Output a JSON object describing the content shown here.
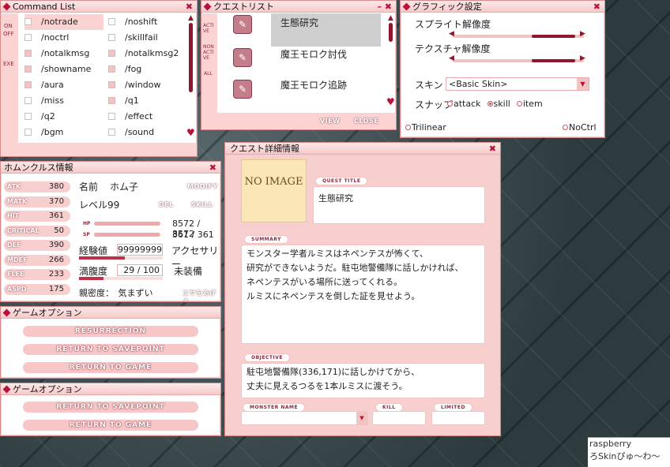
{
  "command_list": {
    "title": "Command List",
    "side": [
      "ON",
      "OFF",
      "EXE"
    ],
    "left": [
      {
        "label": "/notrade",
        "on": false,
        "selected": true
      },
      {
        "label": "/noctrl",
        "on": false
      },
      {
        "label": "/notalkmsg",
        "on": true
      },
      {
        "label": "/showname",
        "on": true
      },
      {
        "label": "/aura",
        "on": true
      },
      {
        "label": "/miss",
        "on": false
      },
      {
        "label": "/q2",
        "on": false
      },
      {
        "label": "/bgm",
        "on": false
      }
    ],
    "right": [
      {
        "label": "/noshift",
        "on": false
      },
      {
        "label": "/skillfail",
        "on": false
      },
      {
        "label": "/notalkmsg2",
        "on": true
      },
      {
        "label": "/fog",
        "on": true
      },
      {
        "label": "/window",
        "on": true
      },
      {
        "label": "/q1",
        "on": true
      },
      {
        "label": "/effect",
        "on": false
      },
      {
        "label": "/sound",
        "on": false
      }
    ]
  },
  "quest_list": {
    "title": "クエストリスト",
    "side": [
      "ACTI",
      "VE",
      "NON",
      "ACTI",
      "VE",
      "ALL"
    ],
    "items": [
      "生態研究",
      "魔王モロク討伐",
      "魔王モロク追跡"
    ],
    "view_label": "VIEW",
    "close_label": "CLOSE"
  },
  "graphic_settings": {
    "title": "グラフィック設定",
    "sprite_label": "スプライト解像度",
    "texture_label": "テクスチャ解像度",
    "skin_label": "スキン",
    "skin_value": "<Basic Skin>",
    "snap_label": "スナップ",
    "snap_options": [
      {
        "label": "attack",
        "on": false
      },
      {
        "label": "skill",
        "on": true
      },
      {
        "label": "item",
        "on": false
      }
    ],
    "trilinear_label": "Trilinear",
    "noctrl_label": "NoCtrl",
    "sprite_level": 0.6,
    "texture_level": 0.6
  },
  "homunculus": {
    "title": "ホムンクルス情報",
    "stats": [
      {
        "name": "ATK",
        "value": "380"
      },
      {
        "name": "MATK",
        "value": "370"
      },
      {
        "name": "HIT",
        "value": "361"
      },
      {
        "name": "CRITICAL",
        "value": "50"
      },
      {
        "name": "DEF",
        "value": "390"
      },
      {
        "name": "MDEF",
        "value": "266"
      },
      {
        "name": "FLEE",
        "value": "233"
      },
      {
        "name": "ASPD",
        "value": "175"
      }
    ],
    "name_label": "名前",
    "name_value": "ホム子",
    "modify_label": "MODIFY",
    "level_label": "レベル",
    "level_value": "99",
    "del_label": "DEL",
    "skill_label": "SKILL",
    "hp_label": "HP",
    "hp_value": "8572 / 8572",
    "sp_label": "SP",
    "sp_value": "361 / 361",
    "exp_label": "経験値",
    "exp_value": "99999999",
    "accessory_label": "アクセサリー",
    "hunger_label": "満腹度",
    "hunger_value": "29 / 100",
    "equip_value": "未装備",
    "intimacy_label": "親密度：",
    "intimacy_value": "気まずい",
    "feed_label": "エサをあげる",
    "hp_fill": 1.0,
    "sp_fill": 1.0,
    "exp_fill": 0.55,
    "hunger_fill": 0.29
  },
  "game_options_1": {
    "title": "ゲームオプション",
    "buttons": [
      "RESURRECTION",
      "RETURN TO SAVEPOINT",
      "RETURN TO GAME"
    ]
  },
  "game_options_2": {
    "title": "ゲームオプション",
    "buttons": [
      "RETURN TO SAVEPOINT",
      "RETURN TO GAME"
    ]
  },
  "quest_detail": {
    "title": "クエスト詳細情報",
    "no_image": "NO IMAGE",
    "quest_title_tag": "QUEST TITLE",
    "quest_title": "生態研究",
    "summary_tag": "SUMMARY",
    "summary_lines": [
      "モンスター学者ルミスはネペンテスが怖くて、",
      "研究ができないようだ。駐屯地警備隊に話しかければ、",
      "ネペンテスがいる場所に送ってくれる。",
      "ルミスにネペンテスを倒した証を見せよう。"
    ],
    "objective_tag": "OBJECTIVE",
    "objective_lines": [
      "駐屯地警備隊(336,171)に話しかけてから、",
      "丈夫に見えるつるを1本ルミスに渡そう。"
    ],
    "monster_tag": "MONSTER NAME",
    "kill_tag": "KILL",
    "limited_tag": "LIMITED"
  },
  "footer": {
    "line1": "raspberry",
    "line2": "ろSkinぴゅ～わ～"
  }
}
